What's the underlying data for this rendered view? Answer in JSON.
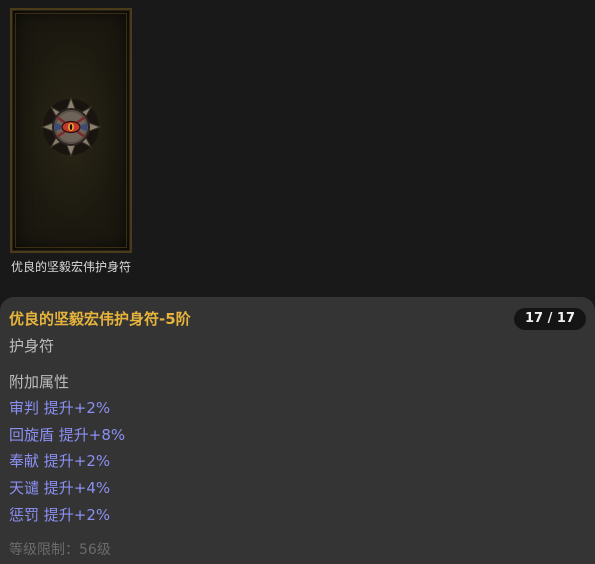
{
  "item": {
    "caption": "优良的坚毅宏伟护身符",
    "icon": "amulet-icon",
    "frame_color": "#4a3b1c"
  },
  "tooltip": {
    "title": "优良的坚毅宏伟护身符-5阶",
    "count": "17 / 17",
    "subtype": "护身符",
    "section_title": "附加属性",
    "attributes": [
      "审判 提升+2%",
      "回旋盾 提升+8%",
      "奉献 提升+2%",
      "天谴 提升+4%",
      "惩罚 提升+2%"
    ],
    "requirement": "等级限制：56级"
  },
  "colors": {
    "title": "#e6b43c",
    "attribute": "#8b8ff2",
    "requirement": "#6b6b6b",
    "panel": "#343434",
    "background": "#191919"
  }
}
